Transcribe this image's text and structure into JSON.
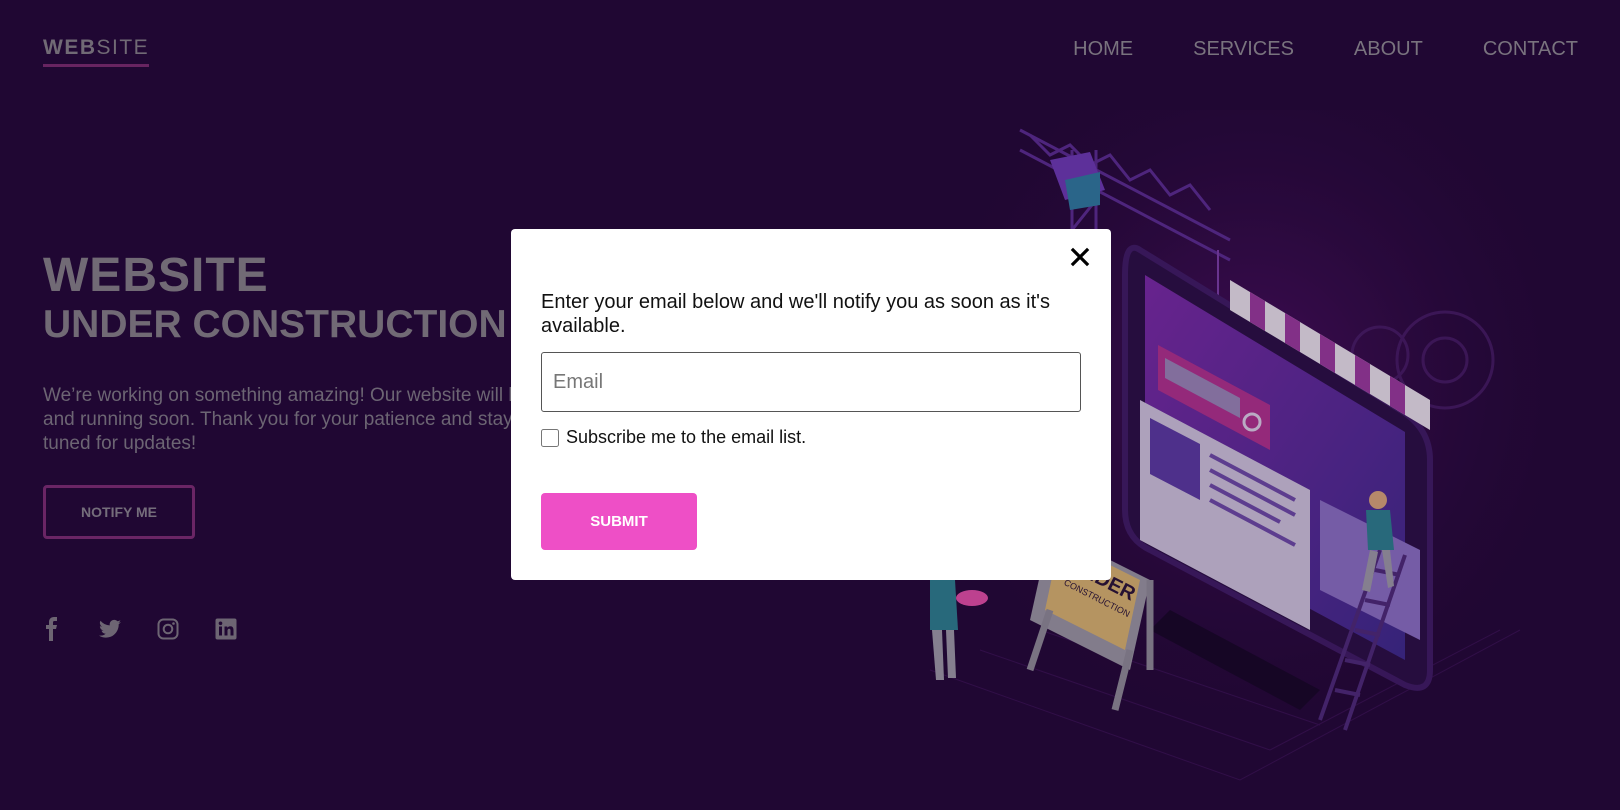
{
  "header": {
    "logo_bold": "WEB",
    "logo_rest": "SITE",
    "nav": [
      {
        "label": "HOME"
      },
      {
        "label": "SERVICES"
      },
      {
        "label": "ABOUT"
      },
      {
        "label": "CONTACT"
      }
    ]
  },
  "hero": {
    "title_line1": "WEBSITE",
    "title_line2": "UNDER CONSTRUCTION",
    "description": "We’re working on something amazing! Our website will be up and running soon. Thank you for your patience and stay tuned for updates!",
    "notify_label": "NOTIFY ME"
  },
  "social": {
    "icons": [
      "facebook-icon",
      "twitter-icon",
      "instagram-icon",
      "linkedin-icon"
    ]
  },
  "illustration": {
    "sign_text_1": "UNDER",
    "sign_text_2": "CONSTRUCTION"
  },
  "modal": {
    "message": "Enter your email below and we'll notify you as soon as it's available.",
    "email_placeholder": "Email",
    "email_value": "",
    "subscribe_label": "Subscribe me to the email list.",
    "subscribe_checked": false,
    "submit_label": "SUBMIT"
  },
  "colors": {
    "background": "#230837",
    "accent": "#ee4fc6",
    "button_border": "#7d2d74"
  }
}
